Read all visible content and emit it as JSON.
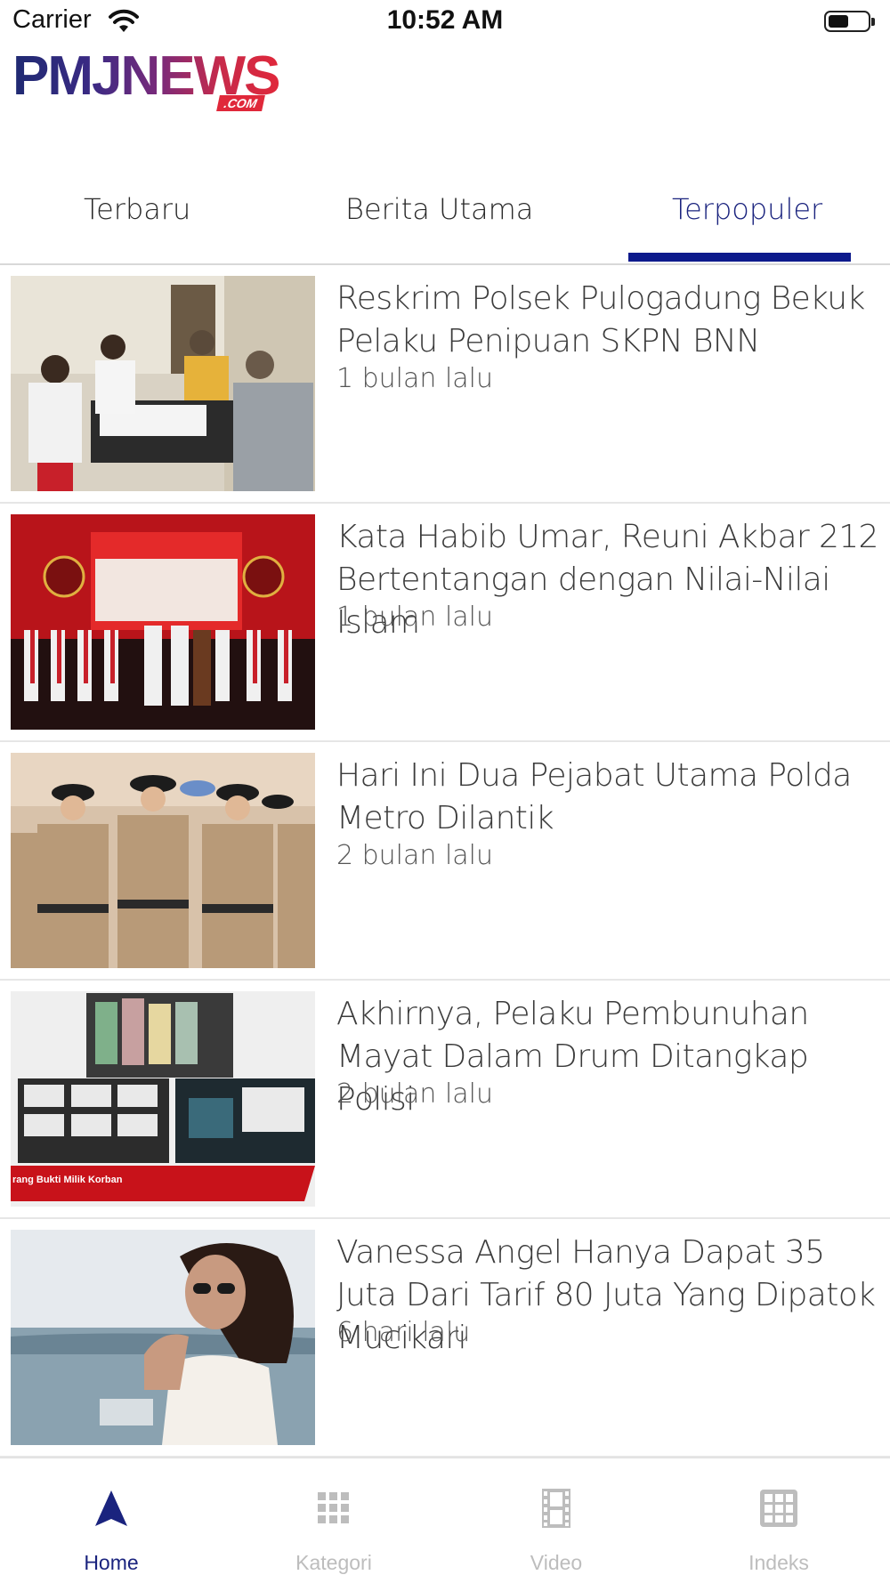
{
  "status": {
    "carrier": "Carrier",
    "time": "10:52 AM"
  },
  "logo": {
    "text": "PMJNEWS",
    "suffix": ".COM"
  },
  "tabs": [
    {
      "label": "Terbaru"
    },
    {
      "label": "Berita Utama"
    },
    {
      "label": "Terpopuler",
      "active": true
    }
  ],
  "articles": [
    {
      "title": "Reskrim Polsek Pulogadung Bekuk Pelaku Penipuan SKPN BNN",
      "age": "1 bulan lalu"
    },
    {
      "title": "Kata Habib Umar, Reuni Akbar 212 Bertentangan dengan Nilai-Nilai Islam",
      "age": "1 bulan lalu"
    },
    {
      "title": "Hari Ini Dua Pejabat Utama Polda Metro Dilantik",
      "age": "2 bulan lalu"
    },
    {
      "title": "Akhirnya, Pelaku Pembunuhan Mayat Dalam Drum Ditangkap Polisi",
      "age": "2 bulan lalu",
      "image_caption": "rang Bukti Milik Korban"
    },
    {
      "title": "Vanessa Angel Hanya Dapat 35 Juta Dari Tarif 80 Juta Yang Dipatok Mucikari",
      "age": "6 hari lalu"
    }
  ],
  "nav": [
    {
      "label": "Home",
      "icon": "navigation-arrow-icon",
      "active": true
    },
    {
      "label": "Kategori",
      "icon": "grid-dots-icon"
    },
    {
      "label": "Video",
      "icon": "film-strip-icon"
    },
    {
      "label": "Indeks",
      "icon": "grid-table-icon"
    }
  ],
  "colors": {
    "accent": "#1a237e",
    "indicator": "#0d1a8c",
    "inactive": "#bdbdbd",
    "brand_red": "#e0283a",
    "brand_blue": "#1f2a72"
  }
}
